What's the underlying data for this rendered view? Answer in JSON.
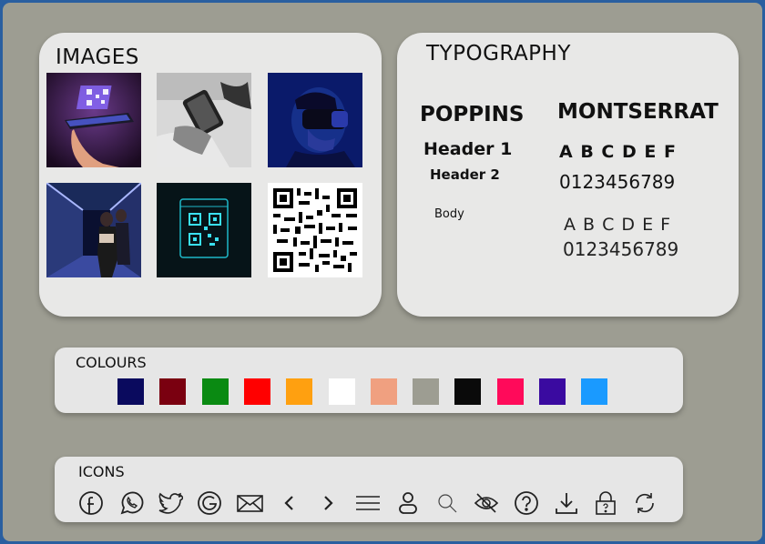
{
  "images": {
    "title": "IMAGES",
    "items": [
      {
        "name": "phone-hologram-qr-image",
        "desc": "hand holding phone with glowing QR"
      },
      {
        "name": "phone-grayscale-image",
        "desc": "hand holding phone black and white"
      },
      {
        "name": "vr-headset-man-image",
        "desc": "man wearing VR headset blue"
      },
      {
        "name": "server-room-woman-image",
        "desc": "woman in server corridor"
      },
      {
        "name": "neon-qr-screen-image",
        "desc": "neon QR code on screen"
      },
      {
        "name": "qr-code-image",
        "desc": "QR code"
      }
    ]
  },
  "typography": {
    "title": "TYPOGRAPHY",
    "poppins": {
      "name": "POPPINS",
      "header1": "Header 1",
      "header2": "Header 2",
      "body": "Body"
    },
    "montserrat": {
      "name": "MONTSERRAT",
      "letters_bold": "A B C D E F",
      "digits_regular": "0123456789",
      "letters_light": "A B C D E F",
      "digits_light": "0123456789"
    }
  },
  "colours": {
    "title": "COLOURS",
    "swatches": [
      "#0a0a5e",
      "#7a0010",
      "#0a8a12",
      "#ff0000",
      "#ffa010",
      "#ffffff",
      "#f0a080",
      "#9d9d92",
      "#0a0a0a",
      "#ff0a5a",
      "#3a0aa0",
      "#1a9aff"
    ]
  },
  "icons": {
    "title": "ICONS",
    "items": [
      "facebook-icon",
      "whatsapp-icon",
      "twitter-icon",
      "google-icon",
      "mail-icon",
      "chevron-left-icon",
      "chevron-right-icon",
      "menu-icon",
      "user-icon",
      "search-icon",
      "eye-off-icon",
      "help-icon",
      "download-icon",
      "lock-help-icon",
      "refresh-icon"
    ]
  }
}
